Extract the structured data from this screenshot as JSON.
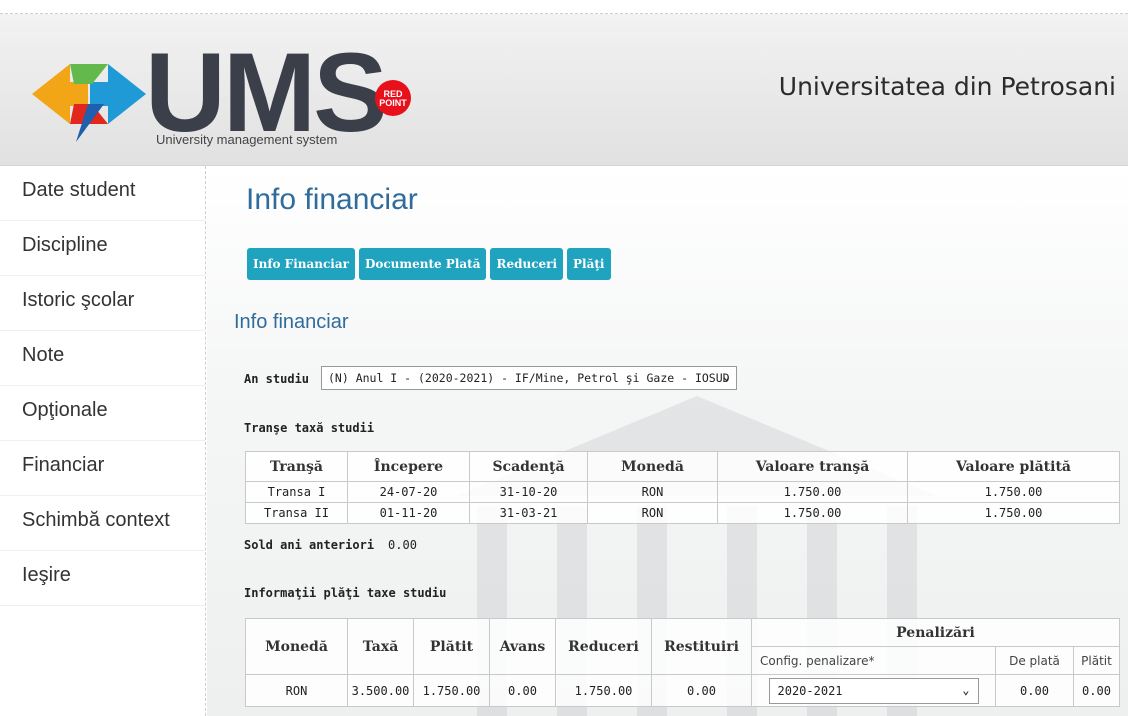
{
  "header": {
    "logo_text": "UMS",
    "logo_subtitle": "University management system",
    "badge_text_1": "RED",
    "badge_text_2": "POINT",
    "university": "Universitatea din Petrosani"
  },
  "sidebar": {
    "items": [
      {
        "label": "Date student"
      },
      {
        "label": "Discipline"
      },
      {
        "label": "Istoric şcolar"
      },
      {
        "label": "Note"
      },
      {
        "label": "Opţionale"
      },
      {
        "label": "Financiar"
      },
      {
        "label": "Schimbă context"
      },
      {
        "label": "Ieşire"
      }
    ]
  },
  "main": {
    "title": "Info financiar",
    "tabs": [
      "Info Financiar",
      "Documente Plată",
      "Reduceri",
      "Plăţi"
    ],
    "subtitle": "Info financiar",
    "an_studiu": {
      "label": "An studiu",
      "value": "(N) Anul I - (2020-2021) - IF/Mine, Petrol şi Gaze - IOSUD"
    },
    "transe": {
      "label": "Tranşe taxă studii",
      "headers": [
        "Tranşă",
        "Începere",
        "Scadenţă",
        "Monedă",
        "Valoare tranşă",
        "Valoare plătită"
      ],
      "rows": [
        [
          "Transa I",
          "24-07-20",
          "31-10-20",
          "RON",
          "1.750.00",
          "1.750.00"
        ],
        [
          "Transa II",
          "01-11-20",
          "31-03-21",
          "RON",
          "1.750.00",
          "1.750.00"
        ]
      ]
    },
    "sold": {
      "label": "Sold ani anteriori",
      "value": "0.00"
    },
    "plati": {
      "label": "Informaţii plăţi taxe studiu",
      "headers": [
        "Monedă",
        "Taxă",
        "Plătit",
        "Avans",
        "Reduceri",
        "Restituiri"
      ],
      "penalizari": {
        "label": "Penalizări",
        "sub_headers": [
          "Config. penalizare*",
          "De plată",
          "Plătit"
        ]
      },
      "row": [
        "RON",
        "3.500.00",
        "1.750.00",
        "0.00",
        "1.750.00",
        "0.00"
      ],
      "config_value": "2020-2021",
      "de_plata": "0.00",
      "platit_pen": "0.00"
    }
  },
  "icons": {
    "chevron": "chevron-down-icon"
  },
  "colors": {
    "accent": "#1fa3bf",
    "title": "#2f6c9c",
    "badge": "#e8111b"
  }
}
